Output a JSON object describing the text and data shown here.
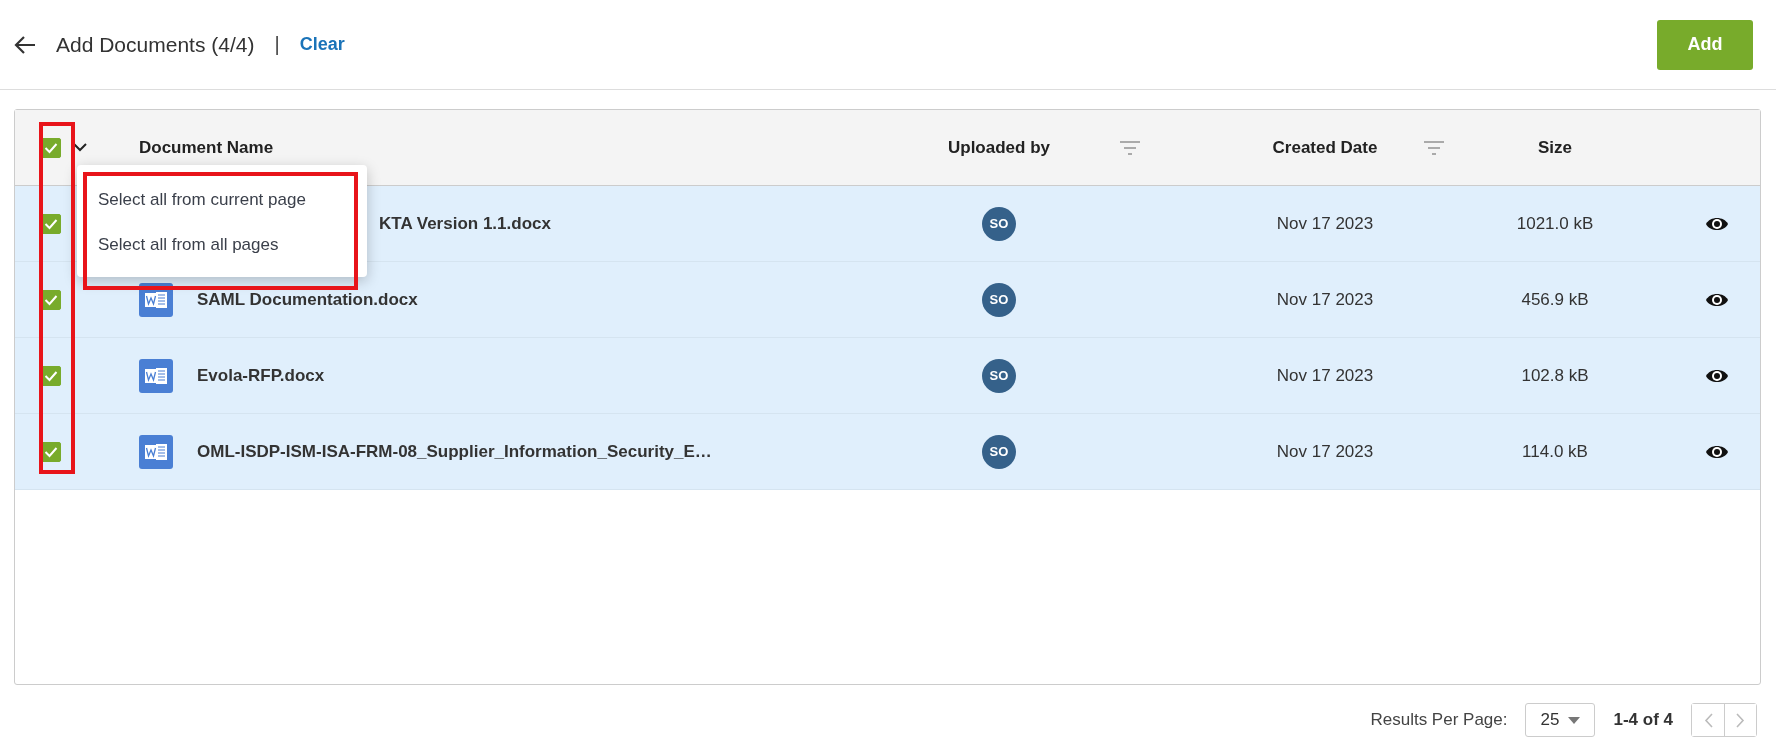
{
  "header": {
    "title": "Add Documents (4/4)",
    "separator": "|",
    "clear_link": "Clear",
    "add_button": "Add"
  },
  "table": {
    "select_all": {
      "checked": true
    },
    "columns": [
      {
        "label": "Document Name",
        "filter": false
      },
      {
        "label": "Uploaded by",
        "filter": true
      },
      {
        "label": "Created Date",
        "filter": true
      },
      {
        "label": "Size",
        "filter": false
      }
    ],
    "rows": [
      {
        "selected": true,
        "icon_hidden": true,
        "name": "KTA Version 1.1.docx",
        "uploader": "SO",
        "date": "Nov 17 2023",
        "size": "1021.0 kB"
      },
      {
        "selected": true,
        "icon_hidden": false,
        "name": "SAML Documentation.docx",
        "uploader": "SO",
        "date": "Nov 17 2023",
        "size": "456.9 kB"
      },
      {
        "selected": true,
        "icon_hidden": false,
        "name": "Evola-RFP.docx",
        "uploader": "SO",
        "date": "Nov 17 2023",
        "size": "102.8 kB"
      },
      {
        "selected": true,
        "icon_hidden": false,
        "name": "OML-ISDP-ISM-ISA-FRM-08_Supplier_Information_Security_E…",
        "uploader": "SO",
        "date": "Nov 17 2023",
        "size": "114.0 kB"
      }
    ]
  },
  "select_menu": {
    "items": [
      "Select all from current page",
      "Select all from all pages"
    ]
  },
  "highlights": {
    "checkbox_column": true,
    "select_menu": true
  },
  "pagination": {
    "label": "Results Per Page:",
    "per_page": "25",
    "range": "1-4 of 4"
  }
}
